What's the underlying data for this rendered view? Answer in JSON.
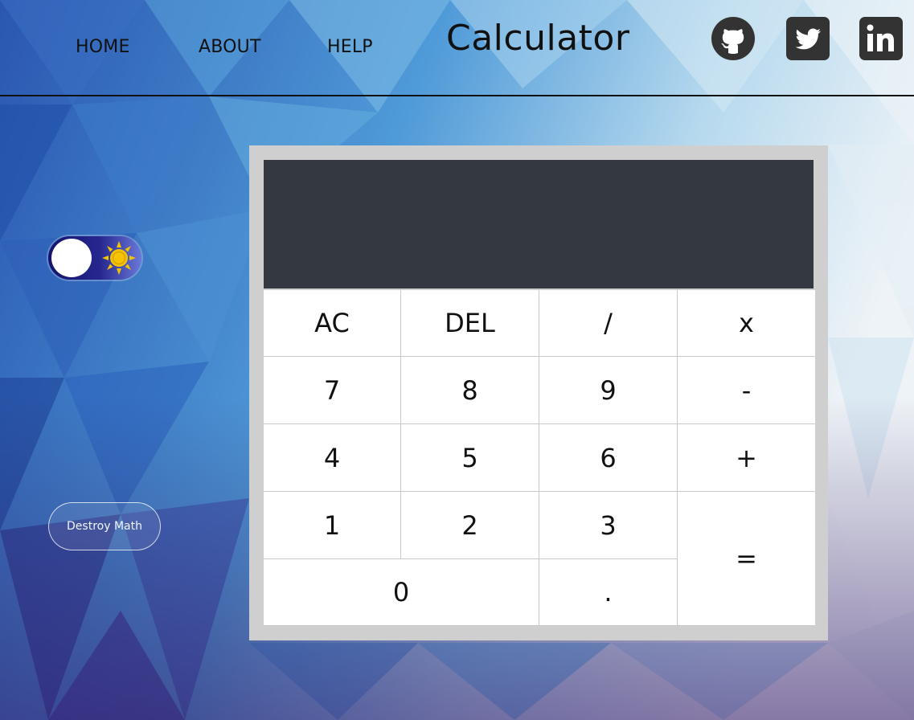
{
  "nav": {
    "home_label": "HOME",
    "about_label": "ABOUT",
    "help_label": "HELP"
  },
  "header": {
    "title": "Calculator"
  },
  "social": [
    "github-icon",
    "twitter-icon",
    "linkedin-icon"
  ],
  "theme_toggle": {
    "icon": "sun-icon"
  },
  "destroy_button": {
    "label": "Destroy Math"
  },
  "calculator": {
    "display": {
      "previous": "",
      "current": ""
    },
    "keys": {
      "ac": "AC",
      "del": "DEL",
      "divide": "/",
      "multiply": "x",
      "seven": "7",
      "eight": "8",
      "nine": "9",
      "minus": "-",
      "four": "4",
      "five": "5",
      "six": "6",
      "plus": "+",
      "one": "1",
      "two": "2",
      "three": "3",
      "equals": "=",
      "zero": "0",
      "decimal": "."
    }
  },
  "colors": {
    "display_bg": "#343840",
    "calc_frame": "#cfcfcf",
    "toggle_dark": "#14146b",
    "sun": "#f5c400"
  }
}
